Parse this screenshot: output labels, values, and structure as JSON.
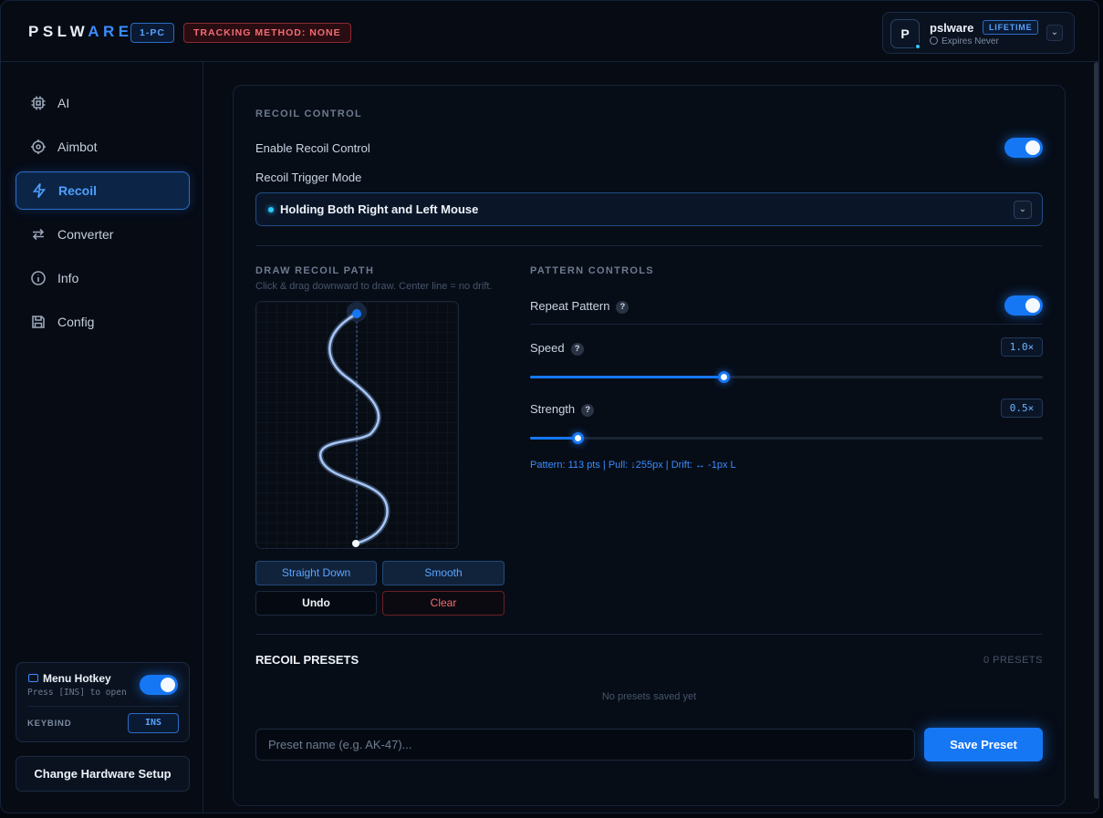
{
  "app": {
    "logo_main": "PSLW",
    "logo_accent": "ARE",
    "pc_badge": "1-PC",
    "tracking_badge": "TRACKING METHOD: NONE"
  },
  "user": {
    "avatar_letter": "P",
    "name": "pslware",
    "plan": "LIFETIME",
    "expires": "Expires Never"
  },
  "sidebar": {
    "items": [
      {
        "label": "AI",
        "icon": "chip-icon"
      },
      {
        "label": "Aimbot",
        "icon": "crosshair-icon"
      },
      {
        "label": "Recoil",
        "icon": "lightning-icon",
        "active": true
      },
      {
        "label": "Converter",
        "icon": "swap-arrows-icon"
      },
      {
        "label": "Info",
        "icon": "info-icon"
      },
      {
        "label": "Config",
        "icon": "save-icon"
      }
    ],
    "hotkey": {
      "title": "Menu Hotkey",
      "subtitle": "Press [INS] to open",
      "enabled": true,
      "keybind_label": "KEYBIND",
      "keybind_value": "INS"
    },
    "hardware_button": "Change Hardware Setup"
  },
  "recoil": {
    "section_title": "RECOIL CONTROL",
    "enable_label": "Enable Recoil Control",
    "enabled": true,
    "trigger_label": "Recoil Trigger Mode",
    "trigger_value": "Holding Both Right and Left Mouse"
  },
  "draw": {
    "title": "DRAW RECOIL PATH",
    "hint": "Click & drag downward to draw. Center line = no drift.",
    "buttons": {
      "straight": "Straight Down",
      "smooth": "Smooth",
      "undo": "Undo",
      "clear": "Clear"
    }
  },
  "pattern": {
    "title": "PATTERN CONTROLS",
    "repeat_label": "Repeat Pattern",
    "repeat_enabled": true,
    "speed_label": "Speed",
    "speed_value": "1.0×",
    "speed_fraction": 0.378,
    "strength_label": "Strength",
    "strength_value": "0.5×",
    "strength_fraction": 0.092,
    "stats": "Pattern: 113 pts | Pull: ↓255px | Drift: ↔ -1px L",
    "help_glyph": "?"
  },
  "presets": {
    "title": "RECOIL PRESETS",
    "count": "0 PRESETS",
    "empty": "No presets saved yet",
    "input_placeholder": "Preset name (e.g. AK-47)...",
    "save_button": "Save Preset"
  },
  "colors": {
    "accent": "#1677f5",
    "accent_text": "#4fa0ff",
    "danger": "#f36b72",
    "background": "#060b14"
  }
}
